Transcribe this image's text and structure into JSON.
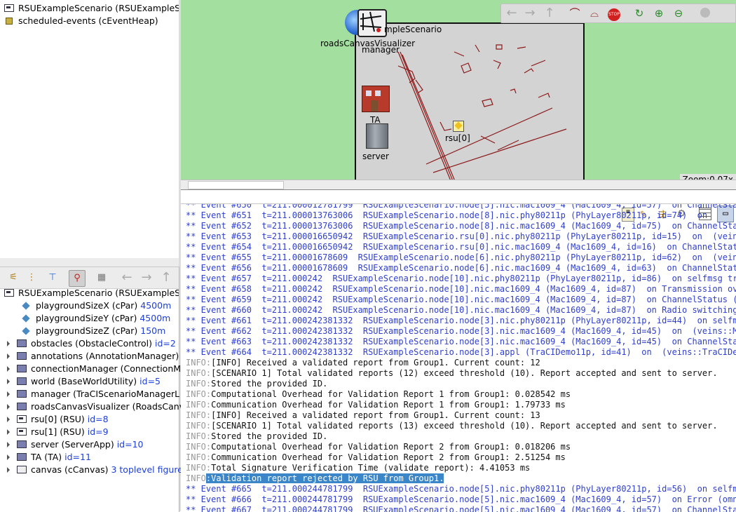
{
  "left_top": {
    "items": [
      {
        "label": "RSUExampleScenario (RSUExampleSc",
        "icon": "module-icon"
      },
      {
        "label": "scheduled-events (cEventHeap)",
        "icon": "heap-icon"
      }
    ]
  },
  "left_bottom": {
    "toolbar": [
      "tree-view-icon",
      "tree-flat-icon",
      "tree-inherit-icon",
      "tree-selected-icon",
      "tree-module-icon",
      "back-icon",
      "forward-icon",
      "up-icon"
    ],
    "tree": [
      {
        "label": "RSUExampleScenario (RSUExampleSc",
        "extra": "",
        "icon": "module"
      },
      {
        "label": "playgroundSizeX (cPar) ",
        "extra": "4500m",
        "icon": "param"
      },
      {
        "label": "playgroundSizeY (cPar) ",
        "extra": "4500m",
        "icon": "param"
      },
      {
        "label": "playgroundSizeZ (cPar) ",
        "extra": "150m",
        "icon": "param"
      },
      {
        "label": "obstacles (ObstacleControl) ",
        "extra": "id=2",
        "icon": "submodule"
      },
      {
        "label": "annotations (AnnotationManager) ",
        "extra": "",
        "icon": "submodule"
      },
      {
        "label": "connectionManager (ConnectionM",
        "extra": "",
        "icon": "submodule"
      },
      {
        "label": "world (BaseWorldUtility) ",
        "extra": "id=5",
        "icon": "submodule"
      },
      {
        "label": "manager (TraCIScenarioManagerL",
        "extra": "",
        "icon": "submodule"
      },
      {
        "label": "roadsCanvasVisualizer (RoadsCanv",
        "extra": "",
        "icon": "submodule"
      },
      {
        "label": "rsu[0] (RSU) ",
        "extra": "id=8",
        "icon": "compound"
      },
      {
        "label": "rsu[1] (RSU) ",
        "extra": "id=9",
        "icon": "compound"
      },
      {
        "label": "server (ServerApp) ",
        "extra": "id=10",
        "icon": "submodule"
      },
      {
        "label": "TA (TA) ",
        "extra": "id=11",
        "icon": "submodule"
      },
      {
        "label": "canvas (cCanvas) ",
        "extra": "3 toplevel figure",
        "icon": "canvas"
      }
    ]
  },
  "canvas": {
    "labels": {
      "title": "mpleScenario",
      "roads": "roadsCanvasVisualizer",
      "manager": "manager",
      "ta": "TA",
      "rsu0": "rsu[0]",
      "server": "server"
    },
    "zoom": "Zoom:0.07x",
    "toolbar": [
      "back-icon",
      "forward-icon",
      "parent-icon",
      "layout-icon",
      "relayout-icon",
      "stop-icon",
      "refresh-icon",
      "zoom-in-icon",
      "zoom-out-icon",
      "circle-icon"
    ],
    "colors": {
      "background": "#a3e0a0",
      "network": "#d3d3d3",
      "roads": "#8b1a1a"
    }
  },
  "log": {
    "toolbar": [
      "copy-icon",
      "find-icon",
      "filter-icon",
      "settings-icon",
      "tabular-icon",
      "module-log-icon"
    ],
    "lines": [
      {
        "type": "event",
        "text": "** Event #650  t=211.000012781799  RSUExampleScenario.node[5].nic.mac1609_4 (Mac1609_4, id=57)  on ChannelStat"
      },
      {
        "type": "event",
        "text": "** Event #651  t=211.000013763006  RSUExampleScenario.node[8].nic.phy80211p (PhyLayer80211p, id=74)  on"
      },
      {
        "type": "event",
        "text": "** Event #652  t=211.000013763006  RSUExampleScenario.node[8].nic.mac1609_4 (Mac1609_4, id=75)  on ChannelStat"
      },
      {
        "type": "event",
        "text": "** Event #653  t=211.000016650942  RSUExampleScenario.rsu[0].nic.phy80211p (PhyLayer80211p, id=15)  on  (veins"
      },
      {
        "type": "event",
        "text": "** Event #654  t=211.000016650942  RSUExampleScenario.rsu[0].nic.mac1609_4 (Mac1609_4, id=16)  on ChannelStat"
      },
      {
        "type": "event",
        "text": "** Event #655  t=211.00001678609  RSUExampleScenario.node[6].nic.phy80211p (PhyLayer80211p, id=62)  on  (vein"
      },
      {
        "type": "event",
        "text": "** Event #656  t=211.00001678609  RSUExampleScenario.node[6].nic.mac1609_4 (Mac1609_4, id=63)  on ChannelStat"
      },
      {
        "type": "event",
        "text": "** Event #657  t=211.000242  RSUExampleScenario.node[10].nic.phy80211p (PhyLayer80211p, id=86)  on selfmsg tr"
      },
      {
        "type": "event",
        "text": "** Event #658  t=211.000242  RSUExampleScenario.node[10].nic.mac1609_4 (Mac1609_4, id=87)  on Transmission ov"
      },
      {
        "type": "event",
        "text": "** Event #659  t=211.000242  RSUExampleScenario.node[10].nic.mac1609_4 (Mac1609_4, id=87)  on ChannelStatus ("
      },
      {
        "type": "event",
        "text": "** Event #660  t=211.000242  RSUExampleScenario.node[10].nic.mac1609_4 (Mac1609_4, id=87)  on Radio switching"
      },
      {
        "type": "event",
        "text": "** Event #661  t=211.000242381332  RSUExampleScenario.node[3].nic.phy80211p (PhyLayer80211p, id=44)  on selfm"
      },
      {
        "type": "event",
        "text": "** Event #662  t=211.000242381332  RSUExampleScenario.node[3].nic.mac1609_4 (Mac1609_4, id=45)  on  (veins::M"
      },
      {
        "type": "event",
        "text": "** Event #663  t=211.000242381332  RSUExampleScenario.node[3].nic.mac1609_4 (Mac1609_4, id=45)  on ChannelStat"
      },
      {
        "type": "event",
        "text": "** Event #664  t=211.000242381332  RSUExampleScenario.node[3].appl (TraCIDemo11p, id=41)  on  (veins::TraCIDe"
      },
      {
        "type": "info",
        "prefix": "INFO:",
        "text": "[INFO] Received a validated report from Group1. Current count: 12"
      },
      {
        "type": "info",
        "prefix": "INFO:",
        "text": "[SCENARIO 1] Total validated reports (12) exceed threshold (10). Report accepted and sent to server."
      },
      {
        "type": "info",
        "prefix": "INFO:",
        "text": "Stored the provided ID."
      },
      {
        "type": "info",
        "prefix": "INFO:",
        "text": "Computational Overhead for Validation Report 1 from Group1: 0.028542 ms"
      },
      {
        "type": "info",
        "prefix": "INFO:",
        "text": "Communication Overhead for Validation Report 1 from Group1: 1.79733 ms"
      },
      {
        "type": "info",
        "prefix": "INFO:",
        "text": "[INFO] Received a validated report from Group1. Current count: 13"
      },
      {
        "type": "info",
        "prefix": "INFO:",
        "text": "[SCENARIO 1] Total validated reports (13) exceed threshold (10). Report accepted and sent to server."
      },
      {
        "type": "info",
        "prefix": "INFO:",
        "text": "Stored the provided ID."
      },
      {
        "type": "info",
        "prefix": "INFO:",
        "text": "Computational Overhead for Validation Report 2 from Group1: 0.018206 ms"
      },
      {
        "type": "info",
        "prefix": "INFO:",
        "text": "Communication Overhead for Validation Report 2 from Group1: 2.51254 ms"
      },
      {
        "type": "info",
        "prefix": "INFO:",
        "text": "Total Signature Verification Time (validate report): 4.41053 ms"
      },
      {
        "type": "highlight",
        "prefix": "INFO:",
        "text": ":Validation report rejected by RSU from Group1."
      },
      {
        "type": "event",
        "text": "** Event #665  t=211.000244781799  RSUExampleScenario.node[5].nic.phy80211p (PhyLayer80211p, id=56)  on selfm"
      },
      {
        "type": "event",
        "text": "** Event #666  t=211.000244781799  RSUExampleScenario.node[5].nic.mac1609_4 (Mac1609_4, id=57)  on Error (omn"
      },
      {
        "type": "event",
        "text": "** Event #667  t=211.000244781799  RSUExampleScenario.node[5].nic.mac1609_4 (Mac1609_4, id=57)  on ChannelSta"
      }
    ]
  }
}
